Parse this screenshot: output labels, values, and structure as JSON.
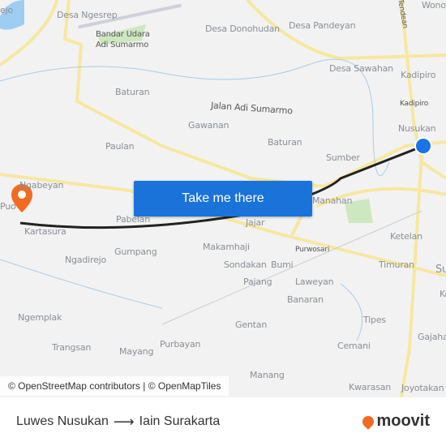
{
  "map": {
    "labels": [
      "Desa Ngesrep",
      "Bandar Udara",
      "Adi Sumarmo",
      "Desa Donohudan",
      "Desa Pandeyan",
      "Wono",
      "Tendean",
      "Desa Sawahan",
      "Kadipiro",
      "Kadipiro",
      "Baturan",
      "Jalan Adi Sumarmo",
      "Gawanan",
      "Nusukan",
      "Paulan",
      "Baturan",
      "Sumber",
      "Ngabeyan",
      "Puo",
      "Kartasura",
      "Pabelan",
      "Jajar",
      "Manahan",
      "Ketelan",
      "Makamhaji",
      "Gumpang",
      "Ngadirejo",
      "Purwosari",
      "Sondakan",
      "Bumi",
      "Timuran",
      "Su",
      "Pajang",
      "Laweyan",
      "Ke",
      "Banaran",
      "Ngemplak",
      "Tipes",
      "Gentan",
      "Trangsan",
      "Mayang",
      "Purbayan",
      "Cemani",
      "Gajaha",
      "Manang",
      "Kwarasan",
      "Joyotakan",
      "ejo"
    ],
    "route_color": "#222222",
    "origin_marker_color": "#1a73e8",
    "destination_marker_color": "#f26b21"
  },
  "cta": {
    "label": "Take me there"
  },
  "attribution": "© OpenStreetMap contributors | © OpenMapTiles",
  "footer": {
    "origin": "Luwes Nusukan",
    "destination": "Iain Surakarta",
    "logo_text": "moovit"
  }
}
